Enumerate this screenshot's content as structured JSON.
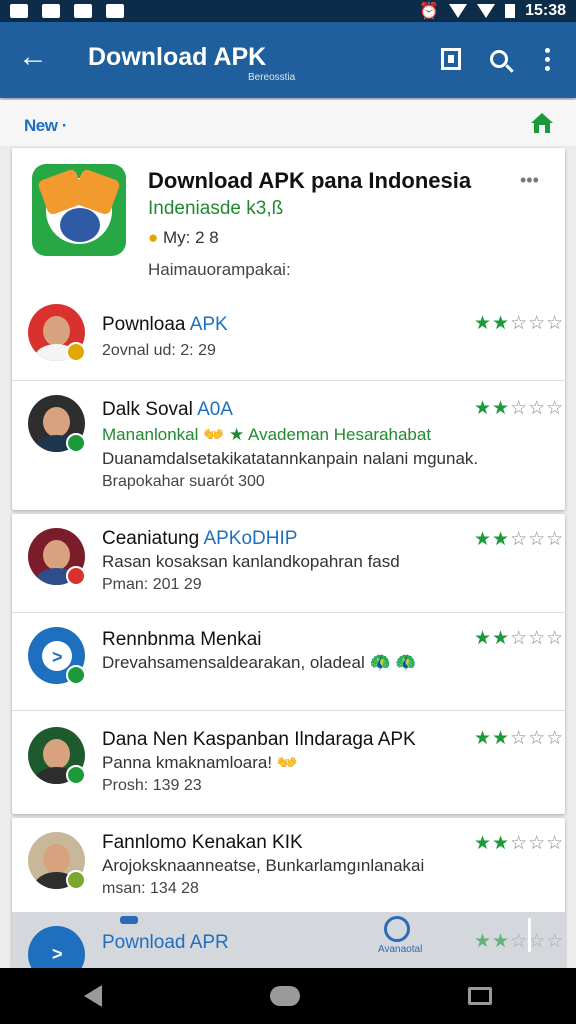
{
  "status_bar": {
    "time": "15:38"
  },
  "app_bar": {
    "title": "Download APK",
    "subtitle": "Bereosstia"
  },
  "subheader": {
    "new_label": "New"
  },
  "featured": {
    "title": "Download APK pana Indonesia",
    "publisher": "Indeniasde k3,ß",
    "meta": "My: 2 8",
    "desc": "Haimauorampakai:",
    "menu_label": "•••"
  },
  "list": [
    {
      "title": "Pownloaa",
      "title_accent": "APK",
      "line2": "2ovnal ud: 2: 29",
      "line3": "",
      "rating": 2,
      "accent": "blue"
    },
    {
      "title": "Dalk Soval",
      "title_accent": "A0A",
      "line2": "Mananlonkal 👐 ★ Avademan Hesarahabat",
      "line2_green": true,
      "line3": "Duanamdalsetakikatatannkanpain nalani mgunak.",
      "line4": "Brapokahar suarót 300",
      "rating": 2,
      "accent": "blue"
    },
    {
      "title": "Ceaniatung",
      "title_accent": "APKoDHIP",
      "line2": "Rasan kosaksan kanlandkopahran fasd",
      "line3": "Pman: 201 29",
      "rating": 2,
      "accent": "blue"
    },
    {
      "title": "Rennbnma Menkai",
      "title_accent": "",
      "line2": "Drevahsamensaldearakan, oladeal 🦚 🦚",
      "line3": "",
      "rating": 2,
      "accent": "blue"
    },
    {
      "title": "Dana Nen Kaspanban Ilndaraga APK",
      "title_accent": "",
      "line2": "Panna kmaknamloara! 👐",
      "line3": "Prosh: 139 23",
      "rating": 2,
      "accent": "blue"
    },
    {
      "title": "Fannlomo Kenakan KIK",
      "title_accent": "",
      "line2": "Arojoksknaanneatse, Bunkarlamgınlanakai",
      "line3": "msan: 134 28",
      "rating": 2,
      "accent": "blue"
    },
    {
      "title": "Pownload",
      "title_accent": "APR",
      "line2": "",
      "line3": "",
      "rating": 2,
      "accent": "blue"
    }
  ],
  "bottom_tab": {
    "label": "Avanaotal"
  },
  "stars": {
    "filled": "★★",
    "empty": "☆☆☆"
  },
  "colors": {
    "appbar": "#1f5f9e",
    "statusbar": "#0c2d4a",
    "accent_green": "#1c9a3a",
    "accent_blue": "#1f6fbf"
  }
}
